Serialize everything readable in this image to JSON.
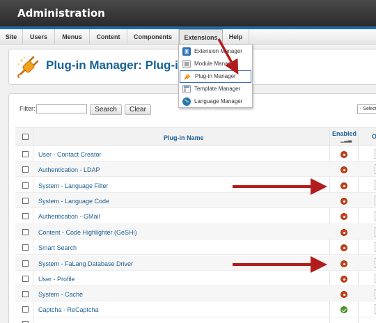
{
  "header": {
    "title": "Administration"
  },
  "menu": {
    "items": [
      {
        "label": "Site"
      },
      {
        "label": "Users"
      },
      {
        "label": "Menus"
      },
      {
        "label": "Content"
      },
      {
        "label": "Components"
      },
      {
        "label": "Extensions",
        "active": true
      },
      {
        "label": "Help"
      }
    ]
  },
  "extensions_dropdown": {
    "items": [
      {
        "label": "Extension Manager",
        "icon": "extension-manager-icon"
      },
      {
        "label": "Module Manager",
        "icon": "module-manager-icon"
      },
      {
        "label": "Plug-in Manager",
        "icon": "plugin-manager-icon",
        "selected": true
      },
      {
        "label": "Template Manager",
        "icon": "template-manager-icon"
      },
      {
        "label": "Language Manager",
        "icon": "language-manager-icon"
      }
    ]
  },
  "page": {
    "title": "Plug-in Manager: Plug-ins",
    "icon": "plug-icon"
  },
  "filter": {
    "label": "Filter:",
    "value": "",
    "search_label": "Search",
    "clear_label": "Clear",
    "select_value": "- Select"
  },
  "table": {
    "columns": {
      "name": "Plug-in Name",
      "enabled": "Enabled",
      "next": "O"
    },
    "rows": [
      {
        "name": "User - Contact Creator",
        "enabled": false
      },
      {
        "name": "Authentication - LDAP",
        "enabled": false
      },
      {
        "name": "System - Language Filter",
        "enabled": false
      },
      {
        "name": "System - Language Code",
        "enabled": false
      },
      {
        "name": "Authentication - GMail",
        "enabled": false
      },
      {
        "name": "Content - Code Highlighter (GeSHi)",
        "enabled": false
      },
      {
        "name": "Smart Search",
        "enabled": false
      },
      {
        "name": "System - FaLang Database Driver",
        "enabled": false
      },
      {
        "name": "User - Profile",
        "enabled": false
      },
      {
        "name": "System - Cache",
        "enabled": false
      },
      {
        "name": "Captcha - ReCaptcha",
        "enabled": true
      }
    ]
  },
  "colors": {
    "header_bg": "#333333",
    "accent": "#1d6aa5",
    "link": "#1d5f92",
    "disabled_status": "#c7421c",
    "enabled_status": "#4e9b1f",
    "annotation_arrow": "#b11d1d"
  }
}
